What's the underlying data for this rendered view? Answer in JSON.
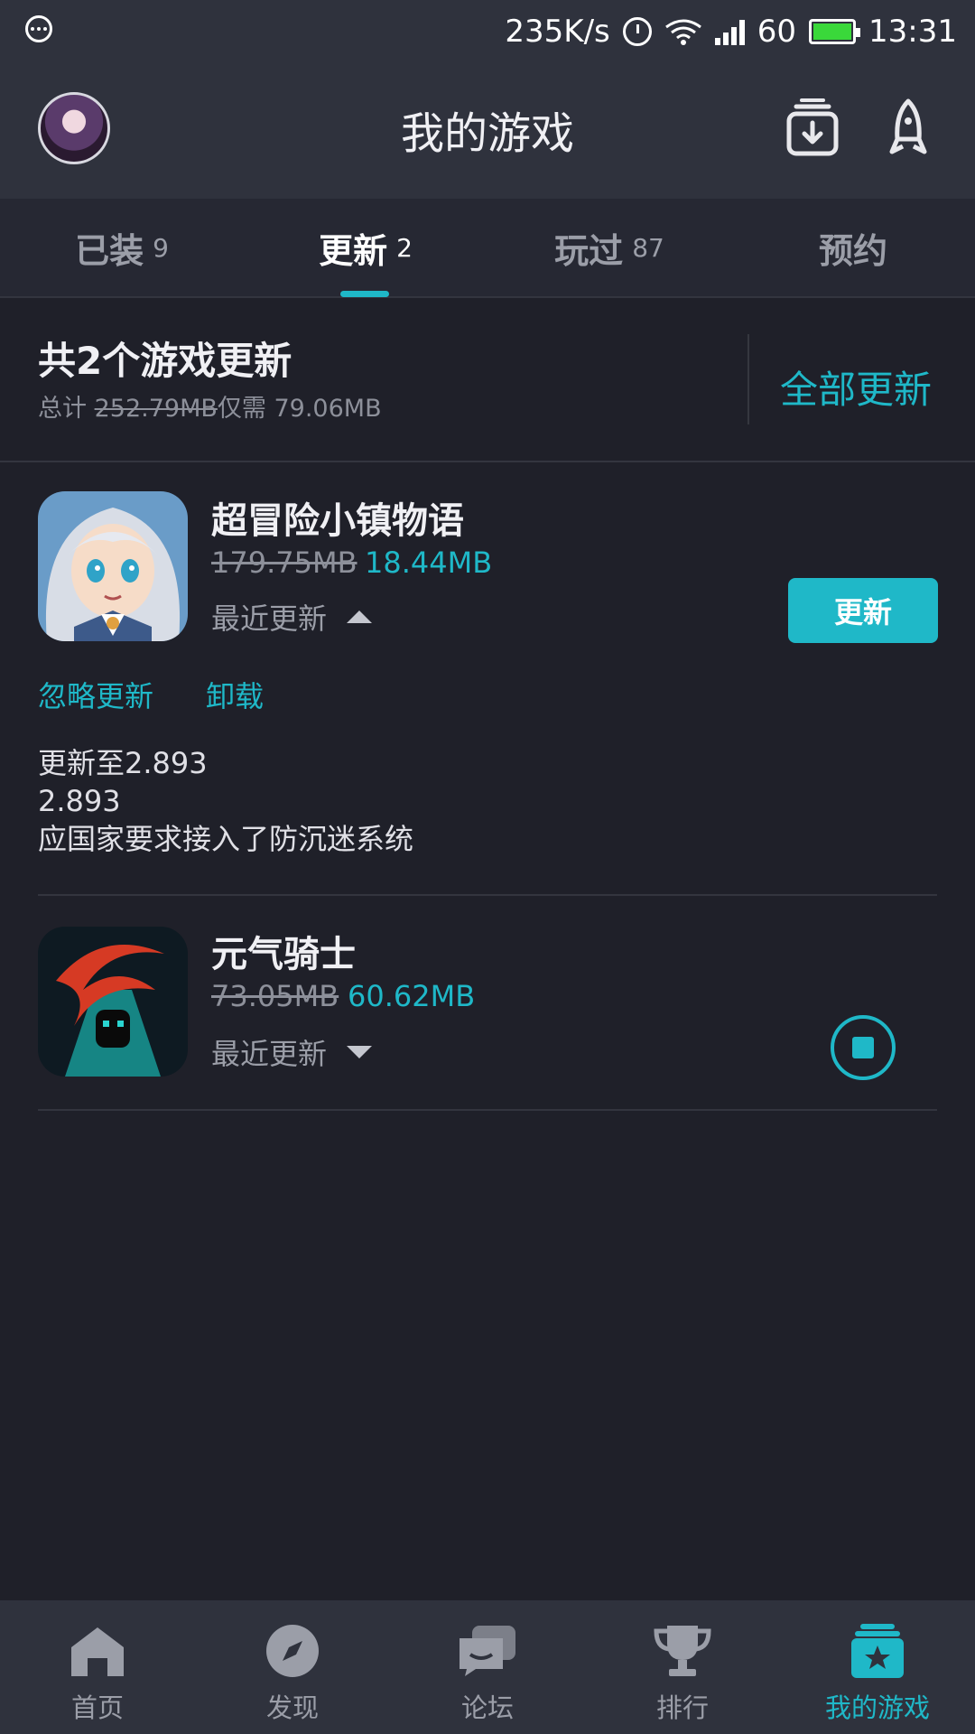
{
  "status_bar": {
    "net_speed": "235K/s",
    "battery_level": "60",
    "time": "13:31",
    "icons": [
      "more-icon",
      "alarm-icon",
      "wifi-icon",
      "signal-icon",
      "battery-icon"
    ]
  },
  "header": {
    "title": "我的游戏"
  },
  "tabs": [
    {
      "label": "已装",
      "count": "9"
    },
    {
      "label": "更新",
      "count": "2"
    },
    {
      "label": "玩过",
      "count": "87"
    },
    {
      "label": "预约",
      "count": ""
    }
  ],
  "active_tab": "更新",
  "summary": {
    "title": "共2个游戏更新",
    "total_prefix": "总计",
    "original_size": "252.79MB",
    "only_need": "仅需",
    "patch_size": "79.06MB",
    "update_all": "全部更新"
  },
  "games": [
    {
      "name": "超冒险小镇物语",
      "original_size": "179.75MB",
      "update_size": "18.44MB",
      "recent_label": "最近更新",
      "button_label": "更新",
      "ignore_label": "忽略更新",
      "uninstall_label": "卸载",
      "notes": [
        "更新至2.893",
        "2.893",
        "应国家要求接入了防沉迷系统"
      ]
    },
    {
      "name": "元气骑士",
      "original_size": "73.05MB",
      "update_size": "60.62MB",
      "recent_label": "最近更新",
      "download_state": "downloading"
    }
  ],
  "bottom_nav": [
    {
      "label": "首页",
      "icon": "home-icon"
    },
    {
      "label": "发现",
      "icon": "compass-icon"
    },
    {
      "label": "论坛",
      "icon": "forum-icon"
    },
    {
      "label": "排行",
      "icon": "trophy-icon"
    },
    {
      "label": "我的游戏",
      "icon": "my-games-icon"
    }
  ],
  "colors": {
    "accent": "#1fb8c8",
    "background": "#1f2029",
    "header": "#2f323d"
  }
}
